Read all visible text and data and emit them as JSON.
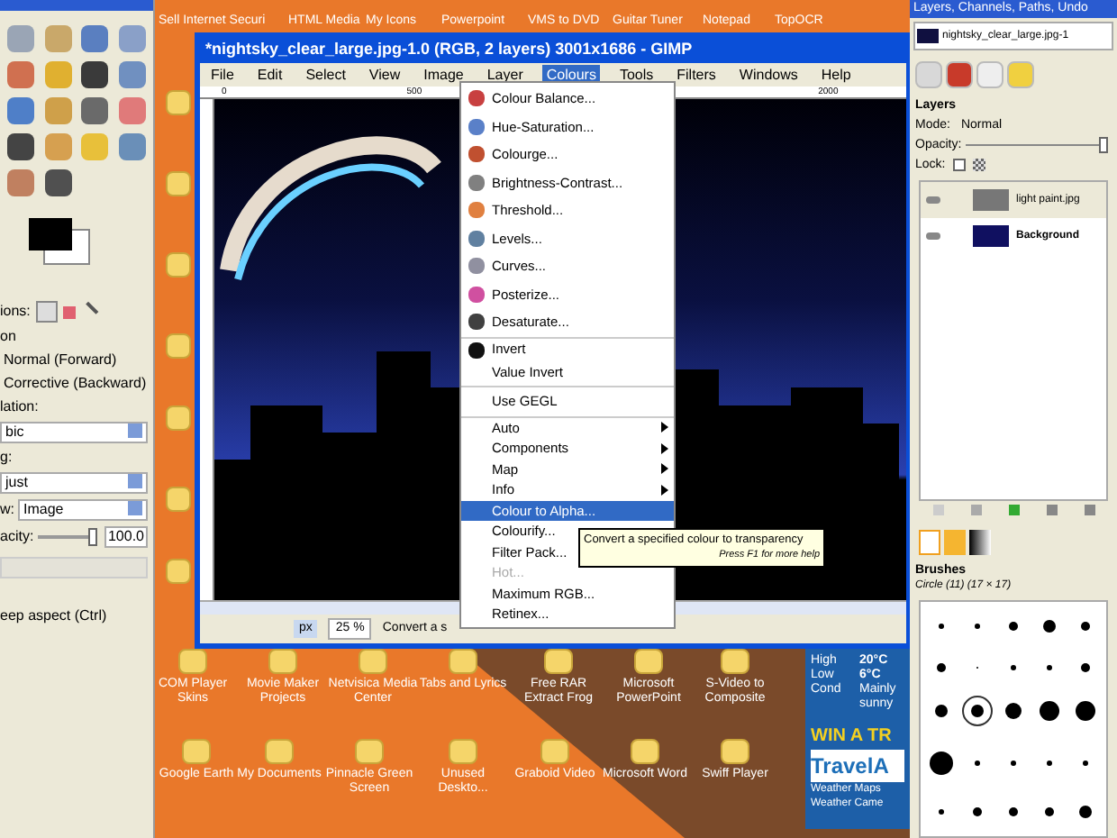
{
  "desktop": {
    "top_icons": [
      "Sell Internet Securi",
      "HTML Media",
      "My Icons",
      "Powerpoint",
      "VMS to DVD",
      "Guitar Tuner",
      "Notepad",
      "TopOCR"
    ],
    "bottom_icons": [
      "COM Player Skins",
      "Movie Maker Projects",
      "Netvisica Media Center",
      "Tabs and Lyrics",
      "Free RAR Extract Frog",
      "Microsoft PowerPoint",
      "S-Video to Composite",
      "Google Earth",
      "My Documents",
      "Pinnacle Green Screen",
      "Unused Deskto...",
      "Graboid Video",
      "Microsoft Word",
      "Swiff Player"
    ],
    "weather": {
      "high_label": "High",
      "low_label": "Low",
      "cond_label": "Cond",
      "high": "20°C",
      "low": "6°C",
      "cond": "Mainly sunny"
    },
    "ad": {
      "headline": "WIN A TR",
      "brand": "TravelA",
      "links": [
        "Weather Maps",
        "Weather Came"
      ]
    }
  },
  "toolbox": {
    "direction_label": "ions:",
    "section": "on",
    "radios": [
      "Normal (Forward)",
      "Corrective (Backward)"
    ],
    "interpolation_label": "lation:",
    "interpolation": "bic",
    "clipping_label": "g:",
    "clipping": "just",
    "preview_label": "w:",
    "preview": "Image",
    "opacity_label": "acity:",
    "opacity": "100.0",
    "opacity_slider": {
      "level": 1
    },
    "keep_aspect": "eep aspect (Ctrl)"
  },
  "gimp_window": {
    "title": "*nightsky_clear_large.jpg-1.0 (RGB, 2 layers) 3001x1686 - GIMP",
    "menu": [
      {
        "label": "File",
        "selected": false
      },
      {
        "label": "Edit",
        "selected": false
      },
      {
        "label": "Select",
        "selected": false
      },
      {
        "label": "View",
        "selected": false
      },
      {
        "label": "Image",
        "selected": false
      },
      {
        "label": "Layer",
        "selected": false
      },
      {
        "label": "Colours",
        "selected": true
      },
      {
        "label": "Tools",
        "selected": false
      },
      {
        "label": "Filters",
        "selected": false
      },
      {
        "label": "Windows",
        "selected": false
      },
      {
        "label": "Help",
        "selected": false
      }
    ],
    "ruler_marks": [
      "0",
      "500",
      "2000"
    ],
    "status": {
      "unit": "px",
      "zoom": "25 %",
      "message": "Convert a s"
    }
  },
  "colours_menu": {
    "groups": [
      [
        {
          "label": "Colour Balance...",
          "submenu": false,
          "selected": false,
          "disabled": false
        },
        {
          "label": "Hue-Saturation...",
          "submenu": false,
          "selected": false,
          "disabled": false
        },
        {
          "label": "Colourge...",
          "submenu": false,
          "selected": false,
          "disabled": false
        },
        {
          "label": "Brightness-Contrast...",
          "submenu": false,
          "selected": false,
          "disabled": false
        },
        {
          "label": "Threshold...",
          "submenu": false,
          "selected": false,
          "disabled": false
        },
        {
          "label": "Levels...",
          "submenu": false,
          "selected": false,
          "disabled": false
        },
        {
          "label": "Curves...",
          "submenu": false,
          "selected": false,
          "disabled": false
        },
        {
          "label": "Posterize...",
          "submenu": false,
          "selected": false,
          "disabled": false
        },
        {
          "label": "Desaturate...",
          "submenu": false,
          "selected": false,
          "disabled": false
        }
      ],
      [
        {
          "label": "Invert",
          "submenu": false,
          "selected": false,
          "disabled": false
        },
        {
          "label": "Value Invert",
          "submenu": false,
          "selected": false,
          "disabled": false
        }
      ],
      [
        {
          "label": "Use GEGL",
          "submenu": false,
          "selected": false,
          "disabled": false
        }
      ],
      [
        {
          "label": "Auto",
          "submenu": true,
          "selected": false,
          "disabled": false
        },
        {
          "label": "Components",
          "submenu": true,
          "selected": false,
          "disabled": false
        },
        {
          "label": "Map",
          "submenu": true,
          "selected": false,
          "disabled": false
        },
        {
          "label": "Info",
          "submenu": true,
          "selected": false,
          "disabled": false
        },
        {
          "label": "Colour to Alpha...",
          "submenu": false,
          "selected": true,
          "disabled": false
        },
        {
          "label": "Colourify...",
          "submenu": false,
          "selected": false,
          "disabled": false
        },
        {
          "label": "Filter Pack...",
          "submenu": false,
          "selected": false,
          "disabled": false
        },
        {
          "label": "Hot...",
          "submenu": false,
          "selected": false,
          "disabled": true
        },
        {
          "label": "Maximum RGB...",
          "submenu": false,
          "selected": false,
          "disabled": false
        },
        {
          "label": "Retinex...",
          "submenu": false,
          "selected": false,
          "disabled": false
        }
      ]
    ]
  },
  "tooltip": {
    "text": "Convert a specified colour to transparency",
    "hint": "Press F1 for more help"
  },
  "layers_dock": {
    "title": "Layers, Channels, Paths, Undo",
    "image": "nightsky_clear_large.jpg-1",
    "heading": "Layers",
    "mode_label": "Mode:",
    "mode": "Normal",
    "opacity_label": "Opacity:",
    "opacity_slider": {
      "level": 1
    },
    "lock_label": "Lock:",
    "lock_pixels": {
      "checked": false
    },
    "layers": [
      {
        "name": "light paint.jpg",
        "selected": true,
        "visible": true
      },
      {
        "name": "Background",
        "selected": false,
        "visible": true
      }
    ],
    "brushes_heading": "Brushes",
    "brush": "Circle (11) (17 × 17)"
  }
}
